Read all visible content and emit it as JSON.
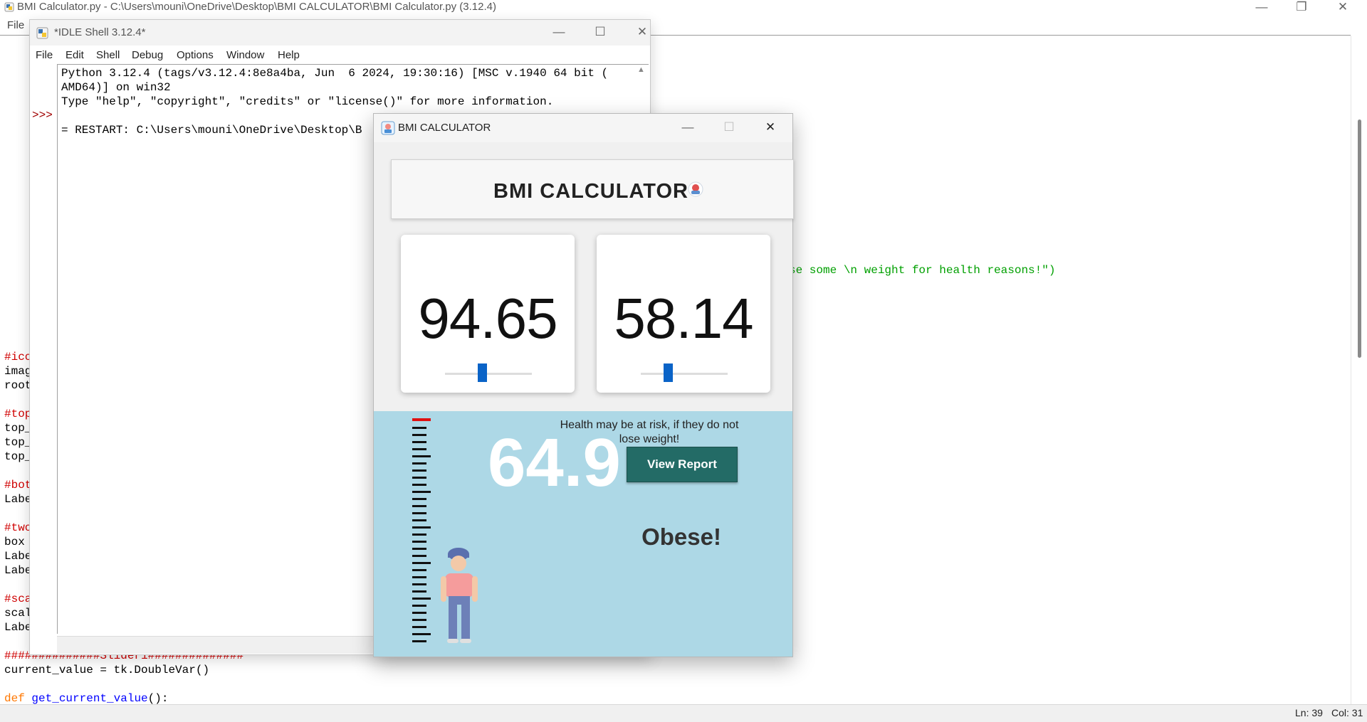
{
  "editor": {
    "title": "BMI Calculator.py - C:\\Users\\mouni\\OneDrive\\Desktop\\BMI CALCULATOR\\BMI Calculator.py (3.12.4)",
    "menu_file": "File",
    "status_ln": "Ln: 39",
    "status_col": "Col: 31",
    "visible_string": "se some \\n weight for health reasons!\")",
    "code_fragments": [
      {
        "text": "#ico",
        "cls": "c-red"
      },
      {
        "text": "imag",
        "cls": "c-black"
      },
      {
        "text": "root",
        "cls": "c-black"
      },
      {
        "text": "",
        "cls": "c-black"
      },
      {
        "text": "#top",
        "cls": "c-red"
      },
      {
        "text": "top_",
        "cls": "c-black"
      },
      {
        "text": "top_",
        "cls": "c-black"
      },
      {
        "text": "top_",
        "cls": "c-black"
      },
      {
        "text": "",
        "cls": "c-black"
      },
      {
        "text": "#bot",
        "cls": "c-red"
      },
      {
        "text": "Labe",
        "cls": "c-black"
      },
      {
        "text": "",
        "cls": "c-black"
      },
      {
        "text": "#two",
        "cls": "c-red"
      },
      {
        "text": "box",
        "cls": "c-black"
      },
      {
        "text": "Labe",
        "cls": "c-black"
      },
      {
        "text": "Labe",
        "cls": "c-black"
      },
      {
        "text": "",
        "cls": "c-black"
      },
      {
        "text": "#sca",
        "cls": "c-red"
      },
      {
        "text": "scal",
        "cls": "c-black"
      },
      {
        "text": "Labe",
        "cls": "c-black"
      }
    ],
    "code_bottom_1": "##############Slider1##############",
    "code_bottom_2": "current_value = tk.DoubleVar()",
    "code_bottom_3_kw": "def",
    "code_bottom_3_fn": "get_current_value",
    "code_bottom_3_rest": "():"
  },
  "shell": {
    "title": "*IDLE Shell 3.12.4*",
    "menus": [
      "File",
      "Edit",
      "Shell",
      "Debug",
      "Options",
      "Window",
      "Help"
    ],
    "lines": [
      "Python 3.12.4 (tags/v3.12.4:8e8a4ba, Jun  6 2024, 19:30:16) [MSC v.1940 64 bit (",
      "AMD64)] on win32",
      "Type \"help\", \"copyright\", \"credits\" or \"license()\" for more information.",
      "",
      "= RESTART: C:\\Users\\mouni\\OneDrive\\Desktop\\B"
    ],
    "prompt": ">>>"
  },
  "bmi_window": {
    "title": "BMI CALCULATOR",
    "header": "BMI CALCULATOR",
    "height_value": "94.65",
    "weight_value": "58.14",
    "height_slider_level": 0.43,
    "weight_slider_level": 0.31,
    "bmi_value": "64.9",
    "message_line1": "Health may be at risk, if they do not",
    "message_line2": "lose weight!",
    "view_report_label": "View Report",
    "status": "Obese!"
  },
  "colors": {
    "accent_blue": "#0a63c7",
    "result_bg": "#add8e6",
    "button_bg": "#236b66",
    "ruler_red": "#e01010"
  },
  "icons": [
    "python-file-icon",
    "idle-shell-icon",
    "bmi-app-icon",
    "minimize-icon",
    "maximize-icon",
    "restore-icon",
    "close-icon",
    "scroll-up-icon",
    "bmi-badge-icon",
    "height-ruler-icon",
    "person-icon"
  ]
}
